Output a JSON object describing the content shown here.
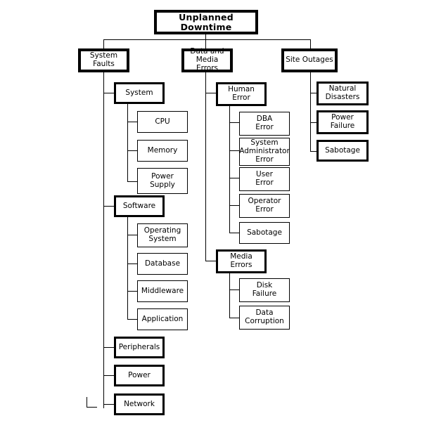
{
  "diagram": {
    "title": "Unplanned Downtime",
    "type": "hierarchical-tree",
    "root": {
      "id": "root",
      "label": "Unplanned Downtime"
    },
    "level1": [
      {
        "id": "system-faults",
        "label": "System\nFaults"
      },
      {
        "id": "data-and-media-errors",
        "label": "Data and\nMedia Errors"
      },
      {
        "id": "site-outages",
        "label": "Site Outages"
      }
    ],
    "system_faults_children": [
      {
        "id": "system",
        "label": "System"
      },
      {
        "id": "software",
        "label": "Software"
      },
      {
        "id": "peripherals",
        "label": "Peripherals"
      },
      {
        "id": "power",
        "label": "Power"
      },
      {
        "id": "network",
        "label": "Network"
      }
    ],
    "system_children": [
      {
        "id": "cpu",
        "label": "CPU"
      },
      {
        "id": "memory",
        "label": "Memory"
      },
      {
        "id": "power-supply",
        "label": "Power\nSupply"
      }
    ],
    "software_children": [
      {
        "id": "operating-system",
        "label": "Operating\nSystem"
      },
      {
        "id": "database",
        "label": "Database"
      },
      {
        "id": "middleware",
        "label": "Middleware"
      },
      {
        "id": "application",
        "label": "Application"
      }
    ],
    "data_media_children": [
      {
        "id": "human-error",
        "label": "Human\nError"
      },
      {
        "id": "media-errors",
        "label": "Media\nErrors"
      }
    ],
    "human_error_children": [
      {
        "id": "dba-error",
        "label": "DBA\nError"
      },
      {
        "id": "system-administrator-error",
        "label": "System\nAdministrator\nError"
      },
      {
        "id": "user-error",
        "label": "User\nError"
      },
      {
        "id": "operator-error",
        "label": "Operator\nError"
      },
      {
        "id": "sabotage-human",
        "label": "Sabotage"
      }
    ],
    "media_errors_children": [
      {
        "id": "disk-failure",
        "label": "Disk\nFailure"
      },
      {
        "id": "data-corruption",
        "label": "Data\nCorruption"
      }
    ],
    "site_outages_children": [
      {
        "id": "natural-disasters",
        "label": "Natural\nDisasters"
      },
      {
        "id": "power-failure",
        "label": "Power\nFailure"
      },
      {
        "id": "sabotage-site",
        "label": "Sabotage"
      }
    ],
    "colors": {
      "line": "#000000",
      "box_border": "#000000",
      "box_fill": "#ffffff",
      "text": "#000000"
    }
  }
}
